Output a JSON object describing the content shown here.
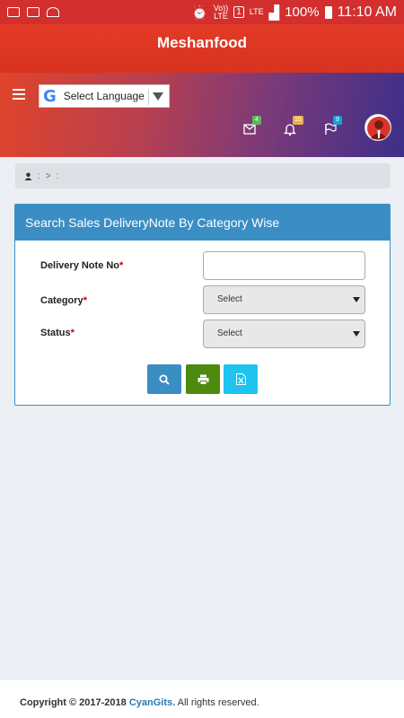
{
  "status_bar": {
    "volte": "Vo))",
    "lte_small": "LTE",
    "sim": "1",
    "lte_signal": "LTE",
    "battery_percent": "100%",
    "time": "11:10 AM"
  },
  "app_bar": {
    "title": "Meshanfood"
  },
  "header": {
    "language_selector": {
      "label": "Select Language",
      "logo": "G"
    },
    "notifications": [
      {
        "icon": "mail-icon",
        "count": "4",
        "color": "#5cb85c"
      },
      {
        "icon": "bell-icon",
        "count": "10",
        "color": "#f0ad4e"
      },
      {
        "icon": "flag-icon",
        "count": "9",
        "color": "#17a2d6"
      }
    ]
  },
  "breadcrumb": {
    "sep1": ":",
    "sep2": ">",
    "sep3": ":"
  },
  "panel": {
    "title": "Search Sales DeliveryNote By Category Wise",
    "fields": {
      "delivery_note_label": "Delivery Note No",
      "delivery_note_value": "",
      "category_label": "Category",
      "category_value": "Select",
      "status_label": "Status",
      "status_value": "Select",
      "required_mark": "*"
    },
    "buttons": {
      "search_color": "#3b8ec4",
      "print_color": "#4f8a10",
      "excel_color": "#1ec3f0"
    }
  },
  "footer": {
    "copyright": "Copyright © 2017-2018 ",
    "brand": "CyanGits.",
    "rights": " All rights reserved."
  }
}
